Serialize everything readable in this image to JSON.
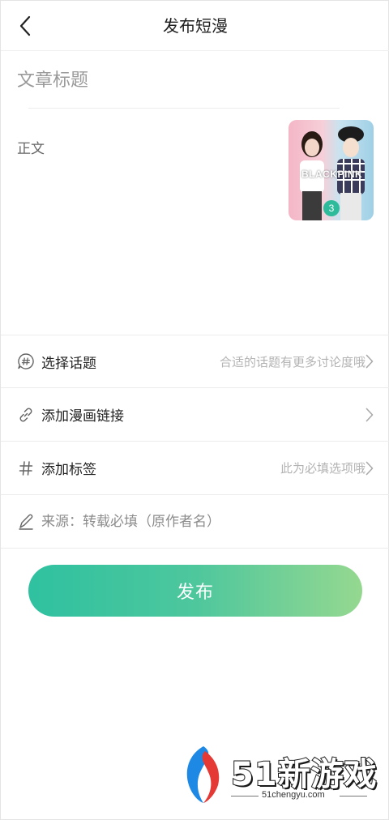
{
  "header": {
    "title": "发布短漫"
  },
  "editor": {
    "title_placeholder": "文章标题",
    "body_placeholder": "正文",
    "thumbnail": {
      "caption": "BLACKPINK",
      "count": "3"
    }
  },
  "options": {
    "topic": {
      "label": "选择话题",
      "hint": "合适的话题有更多讨论度哦"
    },
    "comic_link": {
      "label": "添加漫画链接"
    },
    "tags": {
      "label": "添加标签",
      "hint": "此为必填选项哦"
    },
    "source": {
      "placeholder": "来源：转载必填（原作者名）"
    }
  },
  "publish_label": "发布",
  "watermark": {
    "brand": "51新游戏",
    "url": "51chengyu.com"
  },
  "colors": {
    "accent_start": "#2fc1a0",
    "accent_end": "#95d890",
    "badge": "#2dbb9b"
  }
}
